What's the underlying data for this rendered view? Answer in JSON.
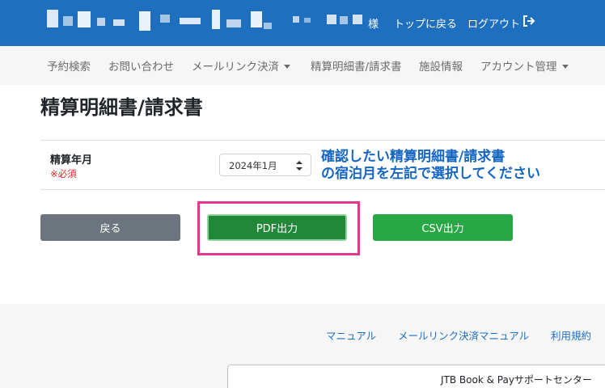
{
  "header": {
    "user_suffix": "様",
    "back_to_top": "トップに戻る",
    "logout": "ログアウト",
    "logout_icon": "logout-icon",
    "bg_color": "#1f6fbf"
  },
  "nav": {
    "items": [
      {
        "label": "予約検索",
        "has_caret": false
      },
      {
        "label": "お問い合わせ",
        "has_caret": false
      },
      {
        "label": "メールリンク決済",
        "has_caret": true
      },
      {
        "label": "精算明細書/請求書",
        "has_caret": false
      },
      {
        "label": "施設情報",
        "has_caret": false
      },
      {
        "label": "アカウント管理",
        "has_caret": true
      }
    ]
  },
  "main": {
    "title": "精算明細書/請求書",
    "field_label": "精算年月",
    "required_label": "※必須",
    "month_select": {
      "value": "2024年1月"
    },
    "instruction_line1": "確認したい精算明細書/請求書",
    "instruction_line2": "の宿泊月を左記で選択してください",
    "instruction_color": "#1566c2"
  },
  "buttons": {
    "back": "戻る",
    "pdf": "PDF出力",
    "csv": "CSV出力"
  },
  "footer": {
    "links": [
      "マニュアル",
      "メールリンク決済マニュアル",
      "利用規約"
    ],
    "support": "JTB Book & Payサポートセンター"
  }
}
